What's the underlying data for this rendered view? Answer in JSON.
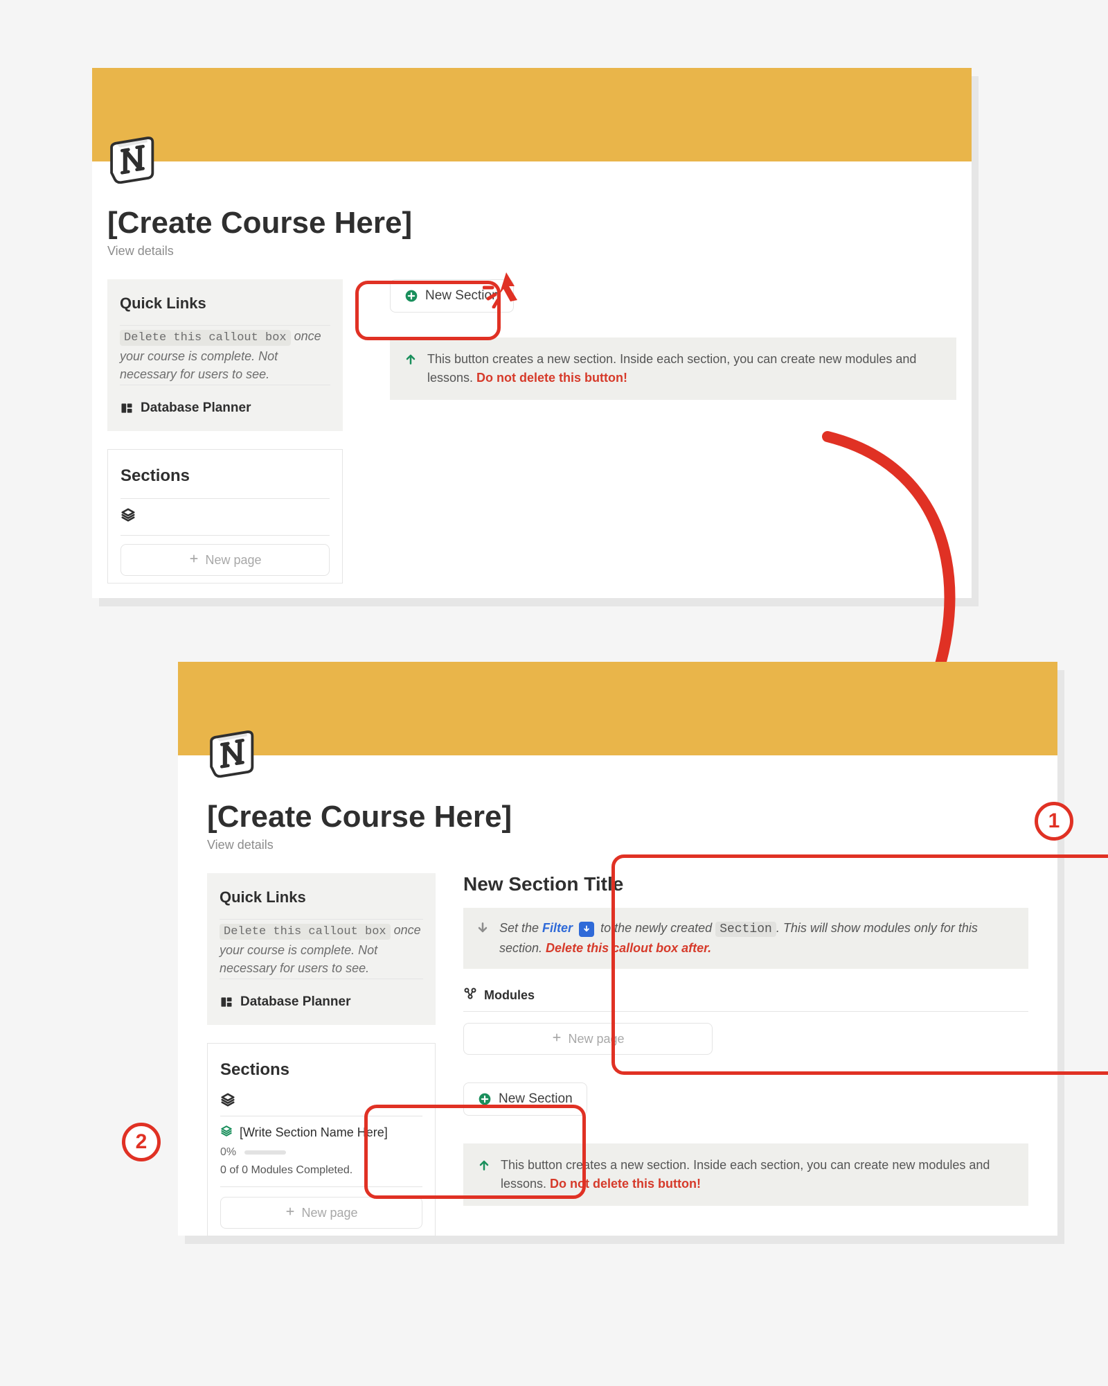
{
  "colors": {
    "accent": "#e9b54a",
    "annotation": "#e03124",
    "green": "#1a8f5c",
    "link": "#2f6ad8",
    "warn": "#d63a2a"
  },
  "panel1": {
    "title": "[Create Course Here]",
    "view_details": "View details",
    "sidebar": {
      "quick_links_heading": "Quick Links",
      "callout_code": "Delete this callout box",
      "callout_rest_1": " once your course is complete. ",
      "callout_rest_2": "Not necessary for users to see.",
      "database_planner": "Database Planner",
      "sections_heading": "Sections",
      "new_page_label": "New page"
    },
    "main": {
      "new_section_label": "New Section",
      "info_text": "This button creates a new section. Inside each section, you can create new modules and lessons. ",
      "info_warn": "Do not delete this button!"
    }
  },
  "panel2": {
    "title": "[Create Course Here]",
    "view_details": "View details",
    "sidebar": {
      "quick_links_heading": "Quick Links",
      "callout_code": "Delete this callout box",
      "callout_rest_1": " once your course is complete. ",
      "callout_rest_2": "Not necessary for users to see.",
      "database_planner": "Database Planner",
      "sections_heading": "Sections",
      "new_page_label": "New page",
      "section_item": {
        "name": "[Write Section Name Here]",
        "percent": "0%",
        "meta": "0 of 0 Modules Completed."
      }
    },
    "main": {
      "section_title_heading": "New Section Title",
      "filter_pre": "Set the ",
      "filter_word": "Filter",
      "filter_mid": " to the newly created ",
      "filter_code": "Section",
      "filter_post": ". This will show modules only for this section. ",
      "filter_warn": "Delete this callout box after.",
      "modules_label": "Modules",
      "new_page_label": "New page",
      "new_section_label": "New Section",
      "info_text": "This button creates a new section. Inside each section, you can create new modules and lessons. ",
      "info_warn": "Do not delete this button!"
    }
  },
  "annotations": {
    "num1": "1",
    "num2": "2"
  }
}
